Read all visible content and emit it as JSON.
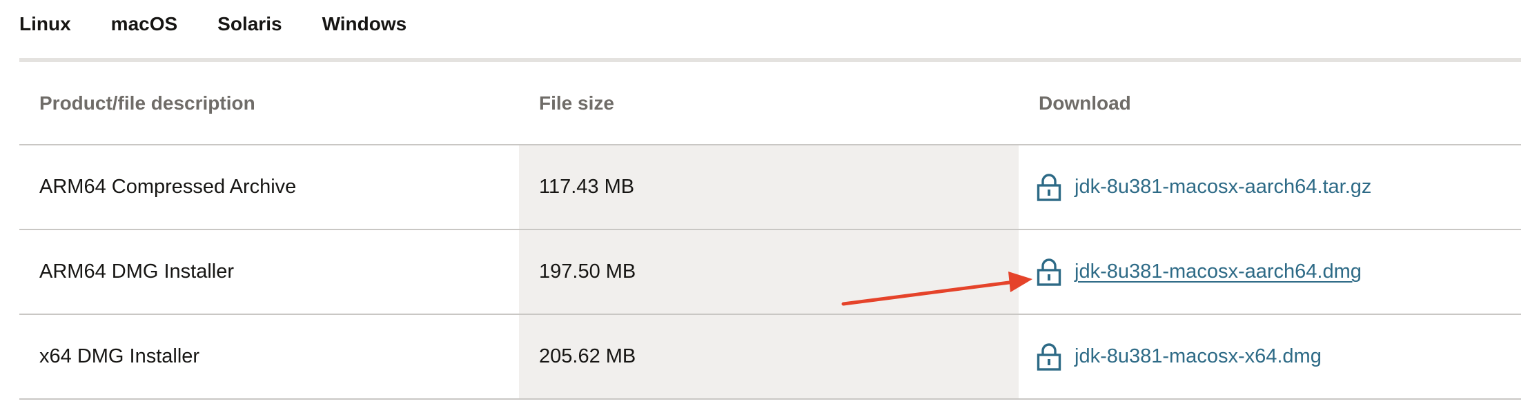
{
  "tabs": [
    {
      "label": "Linux",
      "active": false
    },
    {
      "label": "macOS",
      "active": true
    },
    {
      "label": "Solaris",
      "active": false
    },
    {
      "label": "Windows",
      "active": false
    }
  ],
  "table": {
    "columns": [
      "Product/file description",
      "File size",
      "Download"
    ],
    "rows": [
      {
        "description": "ARM64 Compressed Archive",
        "size": "117.43 MB",
        "file": "jdk-8u381-macosx-aarch64.tar.gz"
      },
      {
        "description": "ARM64 DMG Installer",
        "size": "197.50 MB",
        "file": "jdk-8u381-macosx-aarch64.dmg"
      },
      {
        "description": "x64 DMG Installer",
        "size": "205.62 MB",
        "file": "jdk-8u381-macosx-x64.dmg"
      }
    ]
  },
  "icons": {
    "download": "lock-icon"
  },
  "colors": {
    "active_tab_indicator": "#6f7f5a",
    "link": "#2d6a86",
    "shaded_column": "#f1efed",
    "annotation_arrow": "#e5432a"
  }
}
